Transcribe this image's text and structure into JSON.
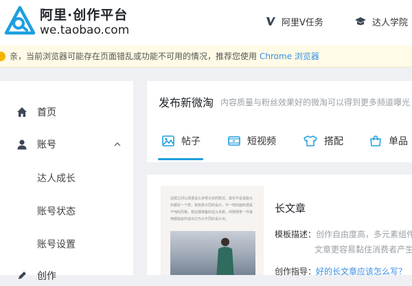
{
  "header": {
    "logo_title": "阿里·创作平台",
    "logo_url": "we.taobao.com",
    "nav": [
      {
        "icon": "v-icon",
        "label": "阿里V任务"
      },
      {
        "icon": "graduation-cap-icon",
        "label": "达人学院"
      }
    ]
  },
  "notice": {
    "text": "亲，当前浏览器可能存在页面错乱或功能不可用的情况，推荐您使用",
    "link": "Chrome 浏览器"
  },
  "sidebar": {
    "items": [
      {
        "icon": "home-icon",
        "label": "首页"
      },
      {
        "icon": "user-icon",
        "label": "账号",
        "expanded": true,
        "children": [
          "达人成长",
          "账号状态",
          "账号设置"
        ]
      },
      {
        "icon": "create-icon",
        "label": "创作"
      }
    ]
  },
  "publish": {
    "title": "发布新微淘",
    "desc": "内容质量与粉丝效果好的微淘可以得到更多频道曝光",
    "tabs": [
      {
        "icon": "image-icon",
        "label": "帖子",
        "active": true
      },
      {
        "icon": "video-icon",
        "label": "短视频"
      },
      {
        "icon": "tshirt-icon",
        "label": "搭配"
      },
      {
        "icon": "shopping-bag-icon",
        "label": "单品"
      }
    ]
  },
  "template": {
    "title": "长文章",
    "desc_key": "模板描述：",
    "desc_value_1": "创作自由度高，多元素组件",
    "desc_value_2": "文章更容易黏住消费者产生",
    "guide_key": "创作指导：",
    "guide_link": "好的长文章应该怎么写？",
    "thumb_text": "这顾之间以漫漫设么多呢大衣的款式，其实不是说能大衣都长一个样，有些款子同的设计，不一样的面料便是千吨的风格，我这期准备的这么多款，你随便拿一件来穿都能给你说出它与众不同的设计点。"
  },
  "colors": {
    "accent": "#1e9ee0",
    "link": "#3a8ee6",
    "notice_bg": "#fffbe6"
  }
}
